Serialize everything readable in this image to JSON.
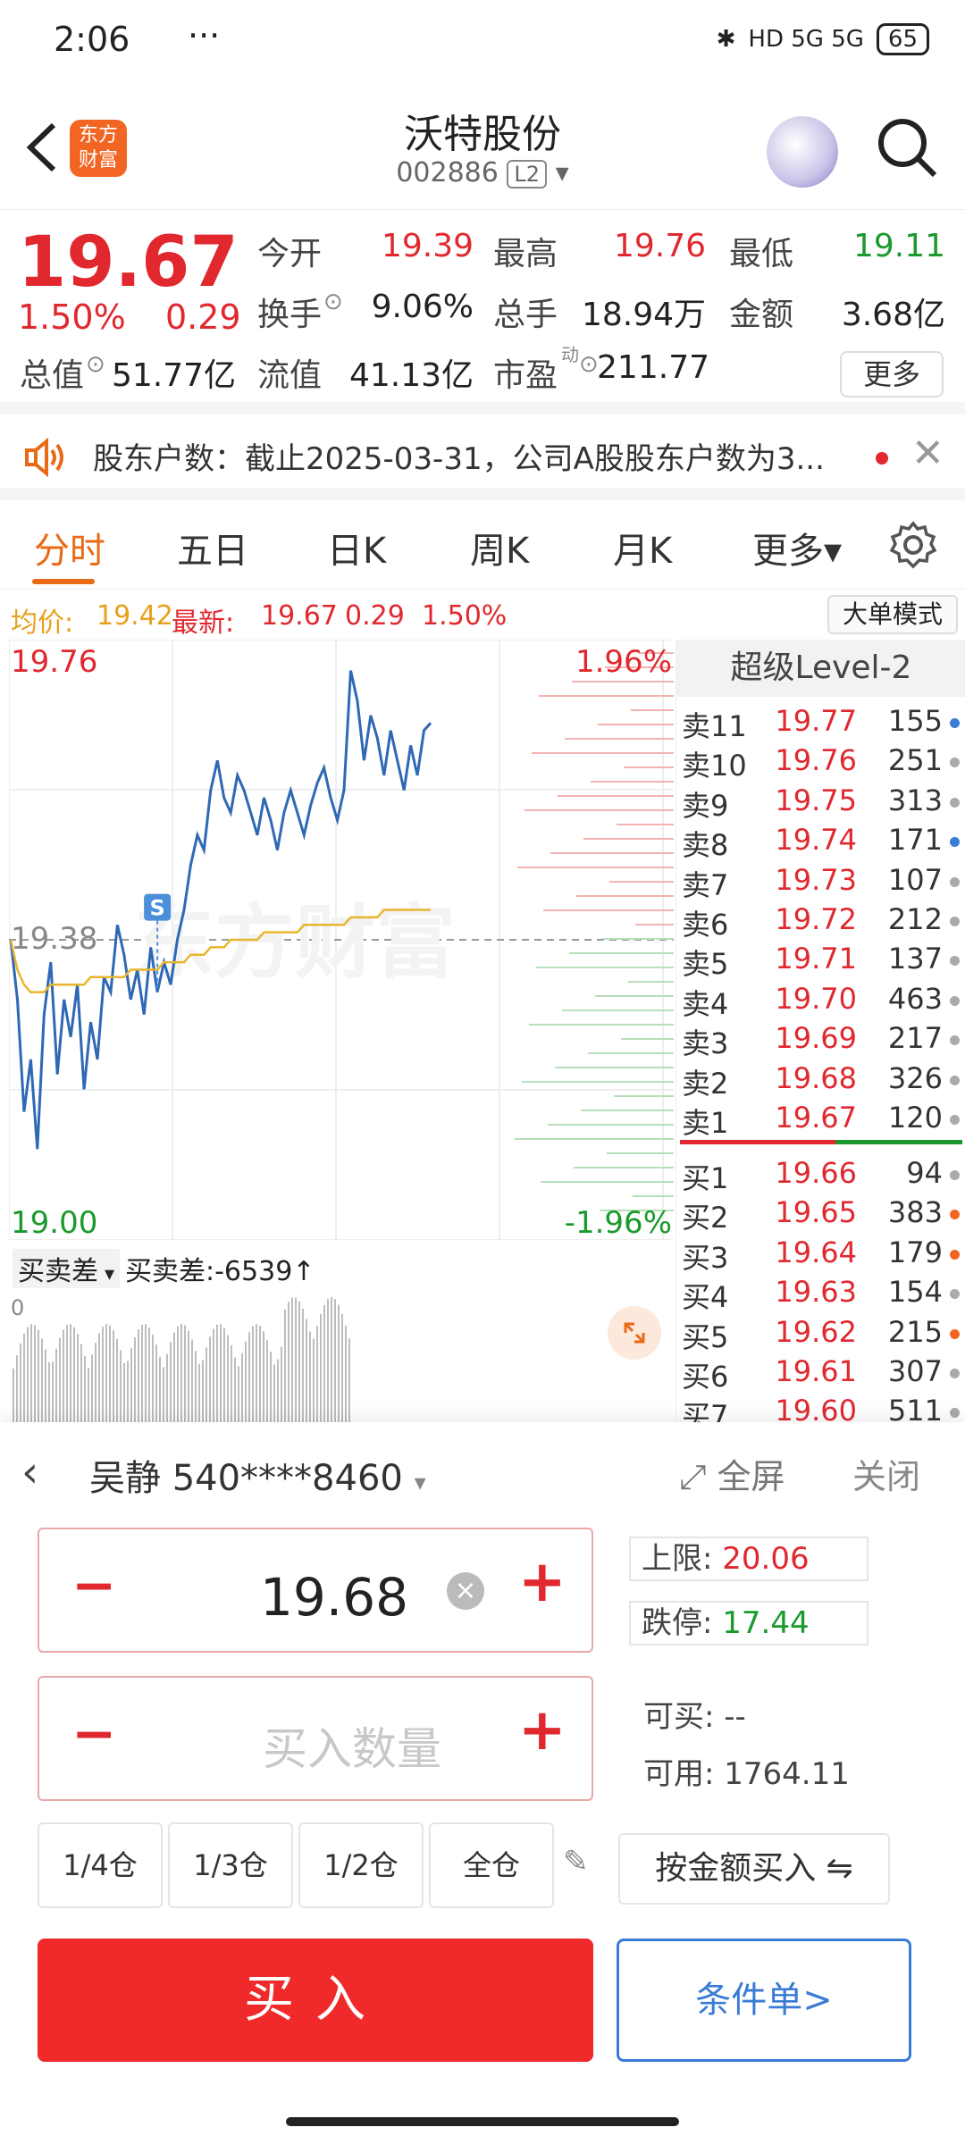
{
  "status_bar": {
    "time": "2:06",
    "dots": "···",
    "network": "HD 5G 5G",
    "battery": "65"
  },
  "header": {
    "logo_text": "东方财富",
    "stock_name": "沃特股份",
    "stock_code": "002886",
    "level_tag": "L2"
  },
  "quote": {
    "price": "19.67",
    "change_pct": "1.50%",
    "change_amt": "0.29",
    "stats": [
      {
        "label": "今开",
        "value": "19.39",
        "color": "red"
      },
      {
        "label": "最高",
        "value": "19.76",
        "color": "red"
      },
      {
        "label": "最低",
        "value": "19.11",
        "color": "green"
      },
      {
        "label": "换手",
        "value": "9.06%",
        "color": "black"
      },
      {
        "label": "总手",
        "value": "18.94万",
        "color": "black"
      },
      {
        "label": "金额",
        "value": "3.68亿",
        "color": "black"
      },
      {
        "label": "总值",
        "value": "51.77亿",
        "color": "black"
      },
      {
        "label": "流值",
        "value": "41.13亿",
        "color": "black"
      },
      {
        "label": "市盈",
        "value": "211.77",
        "color": "black"
      }
    ],
    "pe_superscript": "动",
    "more_label": "更多"
  },
  "notice": {
    "text": "股东户数：截止2025-03-31，公司A股股东户数为3..."
  },
  "tabs": [
    "分时",
    "五日",
    "日K",
    "周K",
    "月K",
    "更多▾"
  ],
  "info_line": {
    "avg_label": "均价:",
    "avg_value": "19.42",
    "latest_label": "最新:",
    "latest_value": "19.67",
    "chg": "0.29",
    "pct": "1.50%",
    "big_order_btn": "大单模式"
  },
  "chart_data": {
    "type": "line",
    "title": "",
    "ylim": [
      19.0,
      19.76
    ],
    "y_top_label": "19.76",
    "y_mid_label": "19.38",
    "y_bottom_label": "19.00",
    "pct_top_label": "1.96%",
    "pct_bottom_label": "-1.96%",
    "marker_label": "S",
    "series": [
      {
        "values": [
          19.38,
          19.3,
          19.15,
          19.22,
          19.1,
          19.28,
          19.35,
          19.2,
          19.3,
          19.25,
          19.32,
          19.18,
          19.27,
          19.22,
          19.33,
          19.31,
          19.4,
          19.36,
          19.3,
          19.34,
          19.28,
          19.37,
          19.31,
          19.35,
          19.32,
          19.38,
          19.42,
          19.48,
          19.52,
          19.5,
          19.58,
          19.62,
          19.57,
          19.55,
          19.6,
          19.58,
          19.55,
          19.52,
          19.57,
          19.54,
          19.5,
          19.55,
          19.58,
          19.55,
          19.52,
          19.56,
          19.59,
          19.61,
          19.57,
          19.54,
          19.58,
          19.74,
          19.7,
          19.62,
          19.68,
          19.65,
          19.6,
          19.66,
          19.62,
          19.58,
          19.64,
          19.6,
          19.66,
          19.67
        ],
        "color": "#2f68b4"
      },
      {
        "values": [
          19.38,
          19.34,
          19.32,
          19.31,
          19.31,
          19.31,
          19.32,
          19.32,
          19.32,
          19.32,
          19.32,
          19.32,
          19.33,
          19.33,
          19.33,
          19.33,
          19.33,
          19.33,
          19.34,
          19.34,
          19.34,
          19.34,
          19.34,
          19.35,
          19.35,
          19.35,
          19.35,
          19.36,
          19.36,
          19.36,
          19.37,
          19.37,
          19.37,
          19.38,
          19.38,
          19.38,
          19.38,
          19.38,
          19.39,
          19.39,
          19.39,
          19.39,
          19.39,
          19.39,
          19.4,
          19.4,
          19.4,
          19.4,
          19.4,
          19.4,
          19.4,
          19.41,
          19.41,
          19.41,
          19.41,
          19.41,
          19.42,
          19.42,
          19.42,
          19.42,
          19.42,
          19.42,
          19.42,
          19.42
        ],
        "color": "#e8b52e"
      }
    ]
  },
  "orderbook": {
    "title": "超级Level-2",
    "sell": [
      {
        "label": "卖11",
        "price": "19.77",
        "vol": "155",
        "dot": "#3a7bd5"
      },
      {
        "label": "卖10",
        "price": "19.76",
        "vol": "251",
        "dot": "#aaaaaa"
      },
      {
        "label": "卖9",
        "price": "19.75",
        "vol": "313",
        "dot": "#aaaaaa"
      },
      {
        "label": "卖8",
        "price": "19.74",
        "vol": "171",
        "dot": "#3a7bd5"
      },
      {
        "label": "卖7",
        "price": "19.73",
        "vol": "107",
        "dot": "#aaaaaa"
      },
      {
        "label": "卖6",
        "price": "19.72",
        "vol": "212",
        "dot": "#aaaaaa"
      },
      {
        "label": "卖5",
        "price": "19.71",
        "vol": "137",
        "dot": "#aaaaaa"
      },
      {
        "label": "卖4",
        "price": "19.70",
        "vol": "463",
        "dot": "#aaaaaa"
      },
      {
        "label": "卖3",
        "price": "19.69",
        "vol": "217",
        "dot": "#aaaaaa"
      },
      {
        "label": "卖2",
        "price": "19.68",
        "vol": "326",
        "dot": "#aaaaaa"
      },
      {
        "label": "卖1",
        "price": "19.67",
        "vol": "120",
        "dot": "#aaaaaa"
      }
    ],
    "buy": [
      {
        "label": "买1",
        "price": "19.66",
        "vol": "94",
        "dot": "#aaaaaa"
      },
      {
        "label": "买2",
        "price": "19.65",
        "vol": "383",
        "dot": "#f26522"
      },
      {
        "label": "买3",
        "price": "19.64",
        "vol": "179",
        "dot": "#f26522"
      },
      {
        "label": "买4",
        "price": "19.63",
        "vol": "154",
        "dot": "#aaaaaa"
      },
      {
        "label": "买5",
        "price": "19.62",
        "vol": "215",
        "dot": "#f26522"
      },
      {
        "label": "买6",
        "price": "19.61",
        "vol": "307",
        "dot": "#aaaaaa"
      },
      {
        "label": "买7",
        "price": "19.60",
        "vol": "511",
        "dot": "#aaaaaa"
      }
    ]
  },
  "subchart": {
    "selector": "买卖差",
    "value_text": "买卖差:-6539↑",
    "zero_label": "0"
  },
  "trade": {
    "account": "吴静 540****8460",
    "fullscreen": "全屏",
    "close": "关闭",
    "price_value": "19.68",
    "qty_placeholder": "买入数量",
    "upper_limit_label": "上限:",
    "upper_limit_value": "20.06",
    "lower_limit_label": "跌停:",
    "lower_limit_value": "17.44",
    "can_buy_label": "可买:",
    "can_buy_value": "--",
    "available_label": "可用:",
    "available_value": "1764.11",
    "position_buttons": [
      "1/4仓",
      "1/3仓",
      "1/2仓",
      "全仓"
    ],
    "by_amount": "按金额买入 ⇋",
    "buy_button": "买入",
    "conditional_button": "条件单>"
  },
  "colors": {
    "up": "#e0282e",
    "down": "#1a9a2c",
    "accent": "#e86a16",
    "blue": "#3a7bd5"
  }
}
